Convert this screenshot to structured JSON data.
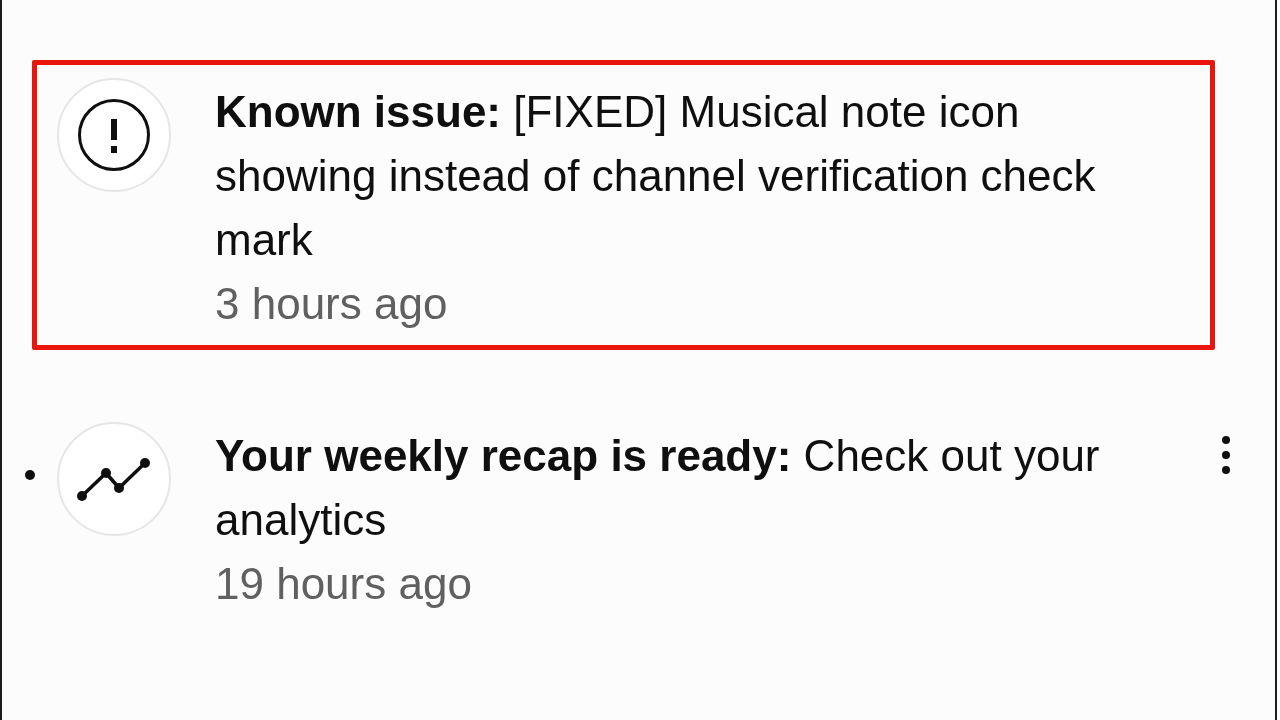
{
  "notifications": [
    {
      "kind": "announcement",
      "title": "**Known issue:** [FIXED] Musical note icon showing instead of channel verification check mark",
      "time": "3 hours ago",
      "unread": false,
      "highlighted": true,
      "has_menu": false
    },
    {
      "kind": "analytics",
      "title": "**Your weekly recap is ready:** Check out your analytics",
      "time": "19 hours ago",
      "unread": true,
      "highlighted": false,
      "has_menu": true
    }
  ]
}
